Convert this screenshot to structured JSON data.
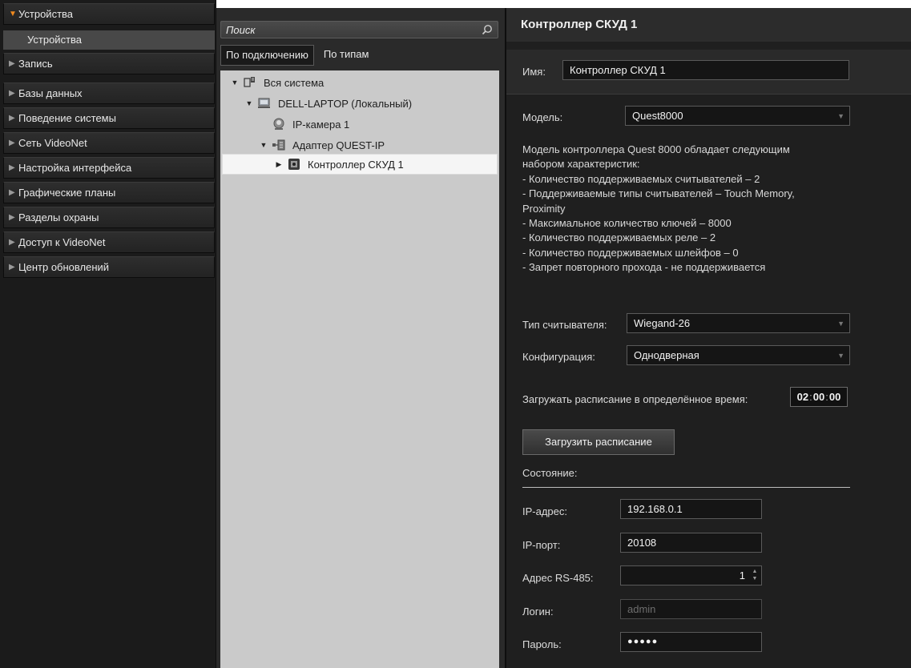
{
  "sidebar": {
    "groups": [
      {
        "label": "Устройства",
        "open": true
      },
      {
        "label": "Запись"
      },
      {
        "label": "Базы данных"
      },
      {
        "label": "Поведение системы"
      },
      {
        "label": "Сеть VideoNet"
      },
      {
        "label": "Настройка интерфейса"
      },
      {
        "label": "Графические планы"
      },
      {
        "label": "Разделы охраны"
      },
      {
        "label": "Доступ к VideoNet"
      },
      {
        "label": "Центр обновлений"
      }
    ],
    "sub_item": "Устройства"
  },
  "middle": {
    "search_placeholder": "Поиск",
    "tabs": [
      "По подключению",
      "По типам"
    ],
    "tree": [
      {
        "label": "Вся система",
        "icon": "system-icon"
      },
      {
        "label": "DELL-LAPTOP (Локальный)",
        "icon": "computer-icon"
      },
      {
        "label": "IP-камера 1",
        "icon": "camera-icon"
      },
      {
        "label": "Адаптер QUEST-IP",
        "icon": "adapter-icon"
      },
      {
        "label": "Контроллер СКУД 1",
        "icon": "controller-icon",
        "selected": true
      }
    ]
  },
  "details": {
    "title": "Контроллер СКУД 1",
    "name_label": "Имя:",
    "name_value": "Контроллер СКУД 1",
    "model_label": "Модель:",
    "model_value": "Quest8000",
    "description": [
      "Модель контроллера Quest 8000 обладает следующим",
      "набором характеристик:",
      " - Количество поддерживаемых считывателей – 2",
      " - Поддерживаемые типы считывателей – Touch Memory,",
      "Proximity",
      " - Максимальное количество ключей – 8000",
      " - Количество поддерживаемых реле – 2",
      " - Количество поддерживаемых шлейфов – 0",
      " - Запрет повторного прохода - не поддерживается"
    ],
    "reader_type_label": "Тип считывателя:",
    "reader_type_value": "Wiegand-26",
    "config_label": "Конфигурация:",
    "config_value": "Однодверная",
    "schedule_time_label": "Загружать расписание в определённое время:",
    "schedule_time": {
      "hh": "02",
      "mm": "00",
      "ss": "00"
    },
    "load_button": "Загрузить расписание",
    "state_label": "Состояние:",
    "ip_label": "IP-адрес:",
    "ip_value": "192.168.0.1",
    "port_label": "IP-порт:",
    "port_value": "20108",
    "rs485_label": "Адрес RS-485:",
    "rs485_value": "1",
    "login_label": "Логин:",
    "login_value": "admin",
    "password_label": "Пароль:",
    "password_value": "●●●●●"
  },
  "colors": {
    "accent": "#f08a1e",
    "panel_bg": "#1f1f1f",
    "tree_bg": "#cacaca"
  }
}
